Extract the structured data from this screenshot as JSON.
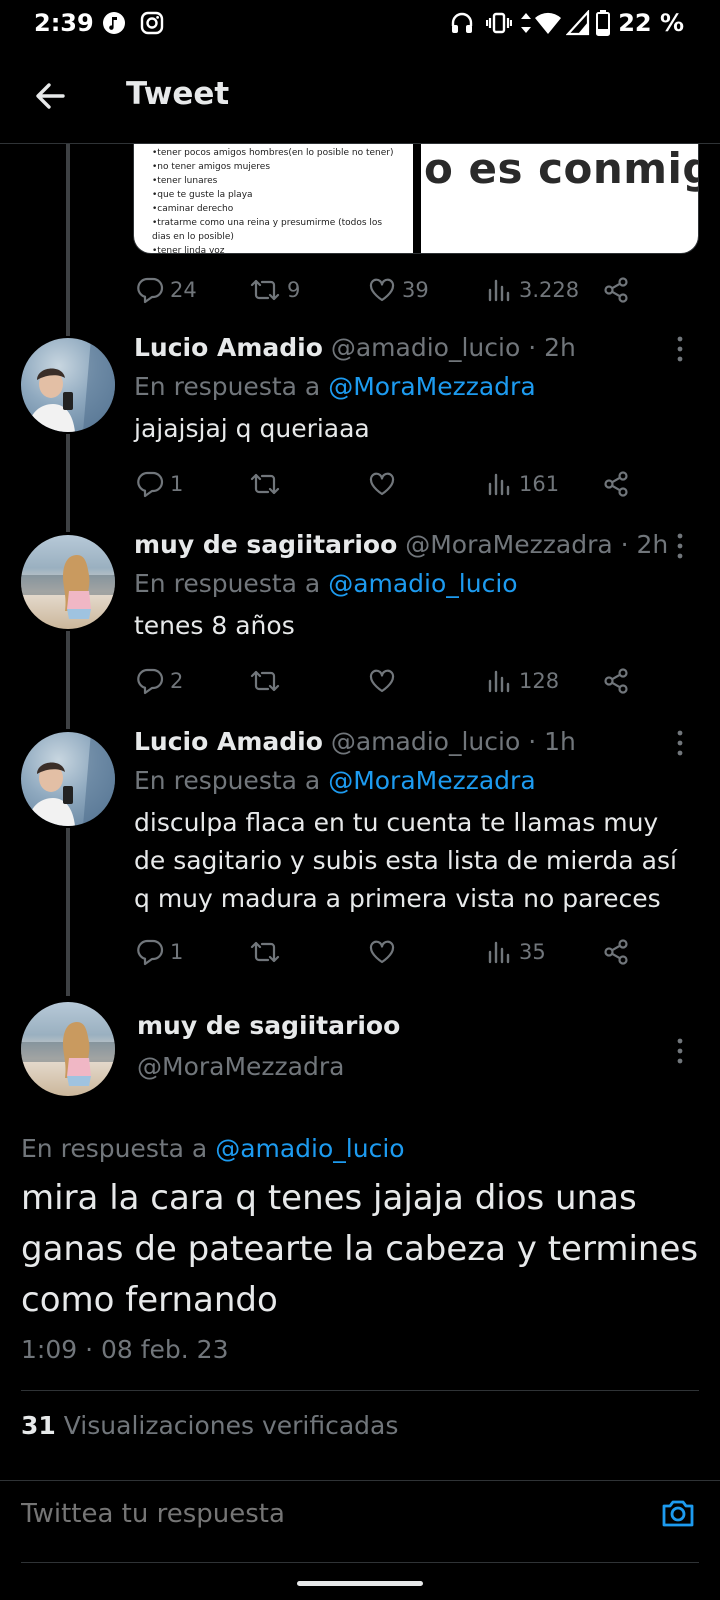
{
  "status_bar": {
    "time": "2:39",
    "battery": "22 %"
  },
  "header": {
    "title": "Tweet"
  },
  "media": {
    "left_lines": [
      "•tener pocos amigos hombres(en lo posible no tener)",
      "•no tener amigos mujeres",
      "•tener lunares",
      "•que te guste la playa",
      "•caminar derecho",
      "•tratarme como una reina y presumirme (todos los",
      "dias en lo posible)",
      "•tener linda voz"
    ],
    "right_text": "o es conmigo"
  },
  "top_actions": {
    "replies": "24",
    "retweets": "9",
    "likes": "39",
    "views": "3.228"
  },
  "replies": [
    {
      "name": "Lucio Amadio",
      "handle": "@amadio_lucio",
      "time": "· 2h",
      "reply_prefix": "En respuesta a",
      "reply_to": "@MoraMezzadra",
      "text": "jajajsjaj q queriaaa",
      "actions": {
        "replies": "1",
        "retweets": "",
        "likes": "",
        "views": "161"
      }
    },
    {
      "name": "muy de sagiitarioo",
      "handle": "@MoraMezzadra",
      "time": "· 2h",
      "reply_prefix": "En respuesta a",
      "reply_to": "@amadio_lucio",
      "text": "tenes 8 años",
      "actions": {
        "replies": "2",
        "retweets": "",
        "likes": "",
        "views": "128"
      }
    },
    {
      "name": "Lucio Amadio",
      "handle": "@amadio_lucio",
      "time": "· 1h",
      "reply_prefix": "En respuesta a",
      "reply_to": "@MoraMezzadra",
      "text": "disculpa flaca en tu cuenta te llamas muy de sagitario y subis esta lista de mierda así q muy madura a primera vista no pareces",
      "actions": {
        "replies": "1",
        "retweets": "",
        "likes": "",
        "views": "35"
      }
    }
  ],
  "main_tweet": {
    "name": "muy de sagiitarioo",
    "handle": "@MoraMezzadra",
    "reply_prefix": "En respuesta a",
    "reply_to": "@amadio_lucio",
    "text": "mira la cara q tenes jajaja dios unas ganas de patearte la cabeza y termines como fernando",
    "timestamp": "1:09 · 08 feb. 23",
    "views_count": "31",
    "views_label": "Visualizaciones verificadas"
  },
  "composer": {
    "placeholder": "Twittea tu respuesta"
  },
  "colors": {
    "background": "#000000",
    "text": "#e7e9ea",
    "secondary": "#71767b",
    "accent": "#1d9bf0",
    "border": "#2f3336"
  }
}
